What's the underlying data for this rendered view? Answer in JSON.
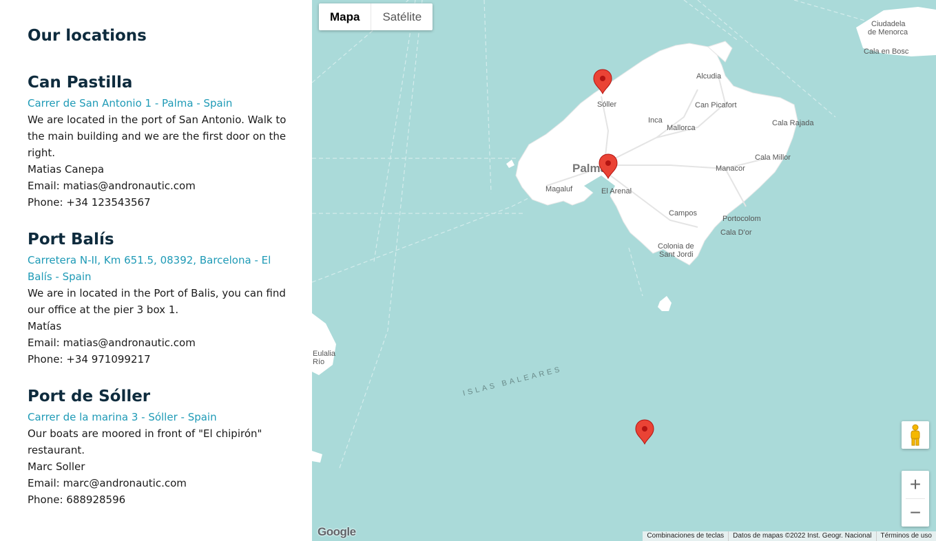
{
  "sidebar": {
    "title": "Our locations",
    "locations": [
      {
        "name": "Can Pastilla",
        "address": "Carrer de San Antonio 1 - Palma - Spain",
        "description": "We are located in the port of San Antonio. Walk to the main building and we are the first door on the right.",
        "contact": "Matias Canepa",
        "email": "Email: matias@andronautic.com",
        "phone": "Phone: +34 123543567"
      },
      {
        "name": "Port Balís",
        "address": "Carretera N-II, Km 651.5, 08392, Barcelona - El Balís - Spain",
        "description": "We are in located in the Port of Balis, you can find our office at the pier 3 box 1.",
        "contact": "Matías",
        "email": "Email: matias@andronautic.com",
        "phone": "Phone: +34 971099217"
      },
      {
        "name": "Port de Sóller",
        "address": "Carrer de la marina 3 - Sóller - Spain",
        "description": "Our boats are moored in front of \"El chipirón\" restaurant.",
        "contact": "Marc Soller",
        "email": "Email: marc@andronautic.com",
        "phone": "Phone: 688928596"
      }
    ]
  },
  "map": {
    "type_buttons": {
      "map": "Mapa",
      "satellite": "Satélite"
    },
    "selected_type": "Mapa",
    "places": {
      "soller": "Sóller",
      "alcudia": "Alcudia",
      "can_picafort": "Can Picafort",
      "inca": "Inca",
      "mallorca": "Mallorca",
      "cala_rajada": "Cala Rajada",
      "palma": "Palma",
      "manacor": "Manacor",
      "cala_millor": "Cala Millor",
      "magaluf": "Magaluf",
      "el_arenal": "El Arenal",
      "campos": "Campos",
      "portocolom": "Portocolom",
      "cala_dor": "Cala D'or",
      "colonia_1": "Colonia de",
      "colonia_2": "Sant Jordi",
      "ciudadela_1": "Ciudadela",
      "ciudadela_2": "de Menorca",
      "cala_en_bosc": "Cala en Bosc",
      "eulalia_1": "Eulalia",
      "eulalia_2": "Río",
      "islas": "ISLAS BALEARES"
    },
    "logo": "Google",
    "footer": {
      "shortcuts": "Combinaciones de teclas",
      "data": "Datos de mapas ©2022 Inst. Geogr. Nacional",
      "terms": "Términos de uso"
    },
    "zoom_in": "+",
    "zoom_out": "−",
    "colors": {
      "water": "#aadad9",
      "land": "#ffffff",
      "marker": "#ea4335"
    }
  }
}
